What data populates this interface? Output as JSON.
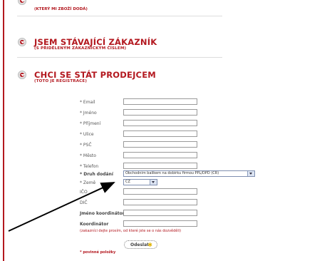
{
  "top": {
    "subtitle": "(KTERÝ MI ZBOŽÍ DODÁ)"
  },
  "sections": [
    {
      "title": "JSEM STÁVAJÍCÍ ZÁKAZNÍK",
      "subtitle": "(S PŘIDĚLENÝM ZÁKAZNICKÝM ČÍSLEM)"
    },
    {
      "title": "CHCI SE STÁT PRODEJCEM",
      "subtitle": "(TOTO JE REGISTRACE)"
    }
  ],
  "form": {
    "fields": [
      {
        "label": "* Email",
        "value": ""
      },
      {
        "label": "* Jméno",
        "value": ""
      },
      {
        "label": "* Příjmení",
        "value": ""
      },
      {
        "label": "* Ulice",
        "value": ""
      },
      {
        "label": "* PSČ",
        "value": ""
      },
      {
        "label": "* Město",
        "value": ""
      },
      {
        "label": "* Telefon",
        "value": ""
      }
    ],
    "delivery": {
      "label": "* Druh dodání",
      "value": "Obchodním balíkem na dobírku firmou PPL/DPD (ČR)"
    },
    "country": {
      "label": "* Země",
      "value": "CZ"
    },
    "extra_fields": [
      {
        "label": "IČO",
        "value": ""
      },
      {
        "label": "DIČ",
        "value": ""
      },
      {
        "label": "Jméno koordinátora",
        "value": ""
      },
      {
        "label": "Koordinátor",
        "value": ""
      }
    ],
    "note": "(zakazníci dejte prosím, od které jste se o nás dozvěděli)",
    "submit_label": "Odeslat",
    "required_note": "* povinné položky"
  },
  "colors": {
    "accent": "#b3181f"
  }
}
